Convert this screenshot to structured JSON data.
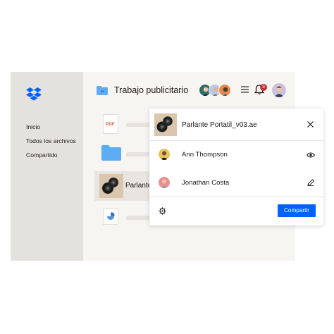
{
  "sidebar": {
    "logo_icon": "dropbox-logo-icon",
    "items": [
      {
        "label": "Inicio"
      },
      {
        "label": "Todos los archivos"
      },
      {
        "label": "Compartido"
      }
    ]
  },
  "header": {
    "title": "Trabajo publicitario",
    "folder_icon": "shared-folder-icon",
    "notification_count": "3",
    "menu_icon": "menu-icon",
    "bell_icon": "bell-icon"
  },
  "file_list": {
    "rows": [
      {
        "type": "pdf",
        "icon_label": "PDF"
      },
      {
        "type": "folder"
      },
      {
        "type": "image",
        "label": "Parlante"
      },
      {
        "type": "document"
      }
    ]
  },
  "share_dialog": {
    "file_name": "Parlante Portatil_v03.ae",
    "people": [
      {
        "name": "Ann Thompson",
        "permission_icon": "eye-icon"
      },
      {
        "name": "Jonathan Costa",
        "permission_icon": "pencil-icon"
      }
    ],
    "settings_icon": "gear-icon",
    "share_label": "Compartir"
  },
  "colors": {
    "accent": "#0061fe",
    "sidebar_bg": "#e4e2de",
    "main_bg": "#f7f5f2",
    "badge": "#c1313e",
    "folder_blue": "#5eacf4"
  }
}
